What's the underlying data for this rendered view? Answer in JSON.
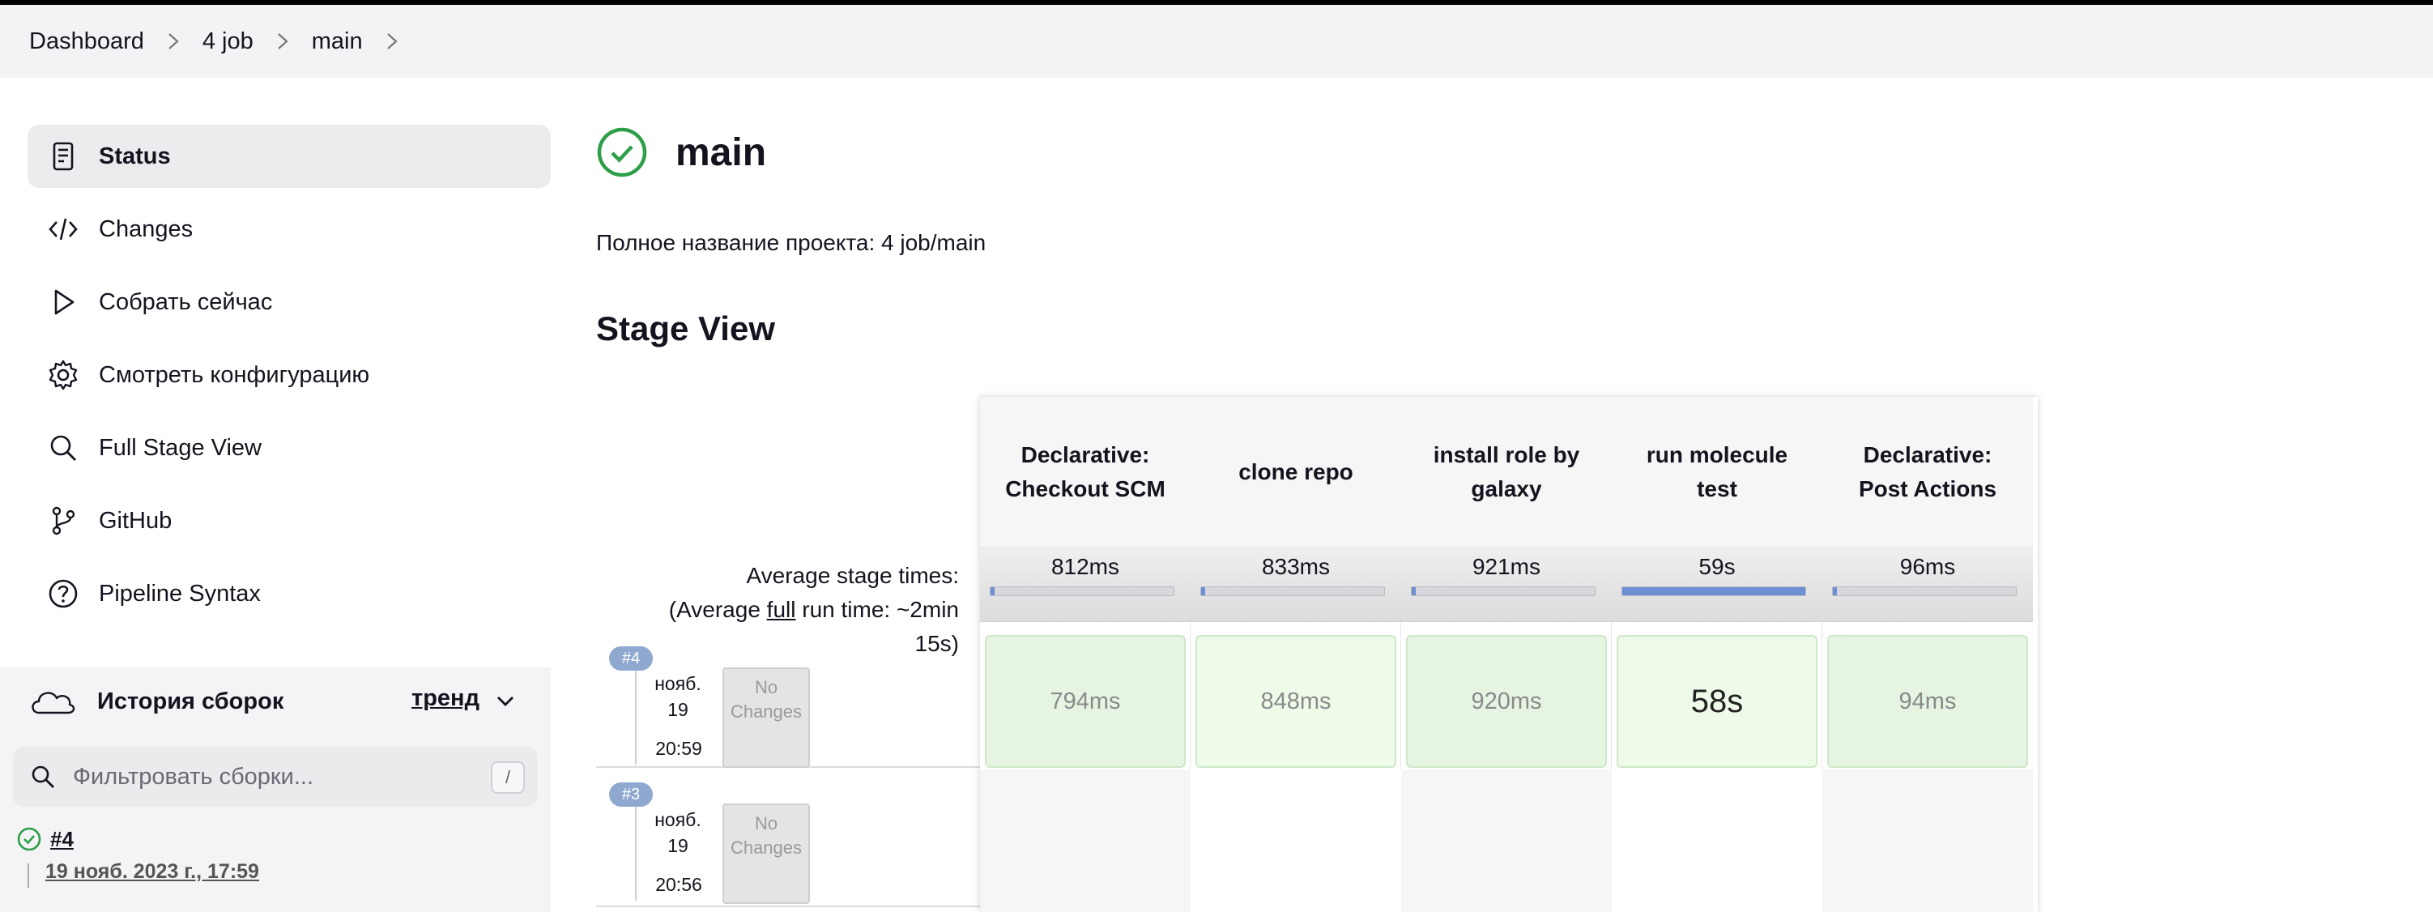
{
  "breadcrumb": [
    "Dashboard",
    "4 job",
    "main"
  ],
  "sidebar": {
    "items": [
      {
        "label": "Status",
        "icon": "status-icon",
        "active": true
      },
      {
        "label": "Changes",
        "icon": "code-icon"
      },
      {
        "label": "Собрать сейчас",
        "icon": "play-icon"
      },
      {
        "label": "Смотреть конфигурацию",
        "icon": "gear-icon"
      },
      {
        "label": "Full Stage View",
        "icon": "search-icon"
      },
      {
        "label": "GitHub",
        "icon": "branch-icon"
      },
      {
        "label": "Pipeline Syntax",
        "icon": "help-icon"
      }
    ]
  },
  "history": {
    "title": "История сборок",
    "trend_label": "тренд",
    "filter_placeholder": "Фильтровать сборки...",
    "filter_shortcut": "/",
    "builds": [
      {
        "number": "#4",
        "date": "19 нояб. 2023 г., 17:59",
        "status": "success"
      }
    ]
  },
  "main": {
    "title": "main",
    "status": "success",
    "full_name": "Полное название проекта: 4 job/main",
    "section_title": "Stage View"
  },
  "stage_view": {
    "avg_label_1": "Average stage times:",
    "avg_label_2a": "(Average ",
    "avg_label_2u": "full",
    "avg_label_2b": " run time: ~2min",
    "avg_label_3": "15s)",
    "stages": [
      {
        "name": "Declarative: Checkout SCM",
        "avg": "812ms",
        "avg_fraction": 0.014
      },
      {
        "name": "clone repo",
        "avg": "833ms",
        "avg_fraction": 0.014
      },
      {
        "name": "install role by galaxy",
        "avg": "921ms",
        "avg_fraction": 0.016
      },
      {
        "name": "run molecule test",
        "avg": "59s",
        "avg_fraction": 1.0
      },
      {
        "name": "Declarative: Post Actions",
        "avg": "96ms",
        "avg_fraction": 0.002
      }
    ],
    "runs": [
      {
        "badge": "#4",
        "date_1": "нояб.",
        "date_2": "19",
        "time": "20:59",
        "changes": "No Changes",
        "durations": [
          "794ms",
          "848ms",
          "920ms",
          "58s",
          "94ms"
        ]
      },
      {
        "badge": "#3",
        "date_1": "нояб.",
        "date_2": "19",
        "time": "20:56",
        "changes": "No Changes",
        "durations": []
      }
    ]
  },
  "colors": {
    "success": "#2e9e48",
    "cell_success": "#e5f5e2",
    "progress": "#6d8fd3",
    "badge": "#8fa8cf"
  }
}
